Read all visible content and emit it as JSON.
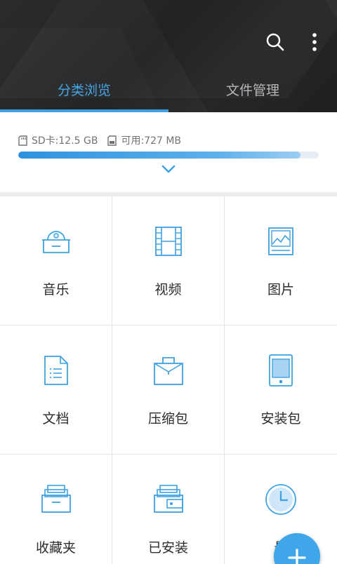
{
  "header": {
    "tabs": [
      {
        "label": "分类浏览",
        "active": true
      },
      {
        "label": "文件管理",
        "active": false
      }
    ],
    "icons": [
      "search-icon",
      "more-vert-icon"
    ],
    "accent_color": "#3fa1e2"
  },
  "storage": {
    "sd_label": "SD卡:12.5 GB",
    "available_label": "可用:727 MB",
    "used_fraction": 0.94
  },
  "categories": [
    {
      "label": "音乐",
      "icon": "music-icon"
    },
    {
      "label": "视频",
      "icon": "video-icon"
    },
    {
      "label": "图片",
      "icon": "image-icon"
    },
    {
      "label": "文档",
      "icon": "document-icon"
    },
    {
      "label": "压缩包",
      "icon": "archive-icon"
    },
    {
      "label": "安装包",
      "icon": "apk-icon"
    },
    {
      "label": "收藏夹",
      "icon": "favorites-icon"
    },
    {
      "label": "已安装",
      "icon": "installed-apps-icon"
    },
    {
      "label": "最",
      "icon": "recent-icon"
    }
  ],
  "fab": {
    "icon": "add-icon"
  }
}
